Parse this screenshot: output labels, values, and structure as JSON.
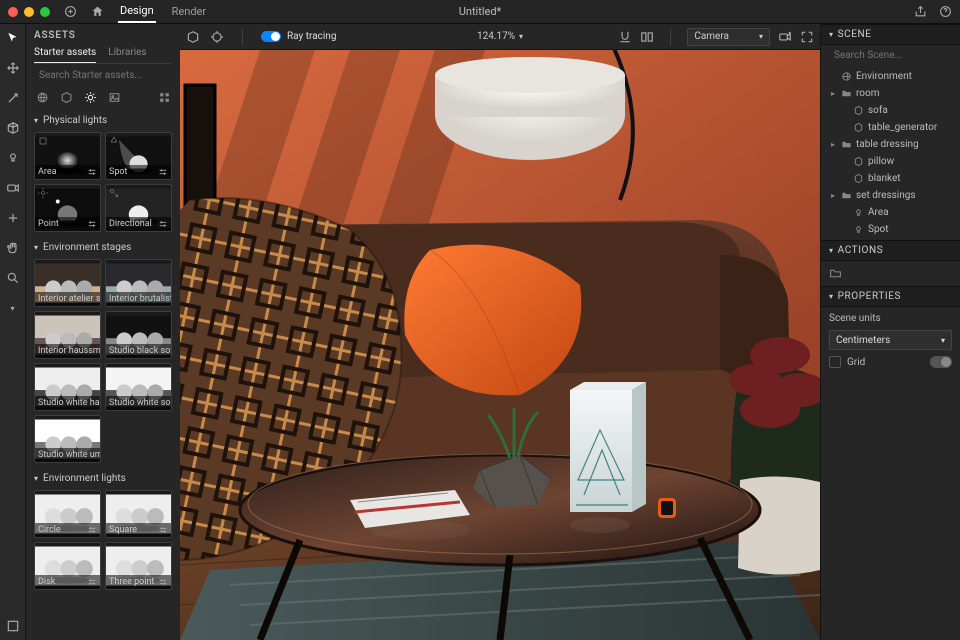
{
  "title": "Untitled*",
  "tabs": {
    "design": "Design",
    "render": "Render"
  },
  "assets": {
    "header": "ASSETS",
    "tabs": {
      "starter": "Starter assets",
      "libraries": "Libraries"
    },
    "search_placeholder": "Search Starter assets...",
    "sections": {
      "physical_lights": "Physical lights",
      "environment_stages": "Environment stages",
      "environment_lights": "Environment lights"
    },
    "lights": [
      {
        "label": "Area"
      },
      {
        "label": "Spot"
      },
      {
        "label": "Point"
      },
      {
        "label": "Directional"
      }
    ],
    "env_stages": [
      {
        "label": "Interior atelier s..."
      },
      {
        "label": "Interior brutalist..."
      },
      {
        "label": "Interior haussm..."
      },
      {
        "label": "Studio black soft..."
      },
      {
        "label": "Studio white ha..."
      },
      {
        "label": "Studio white so..."
      },
      {
        "label": "Studio white um..."
      }
    ],
    "env_lights": [
      {
        "label": "Circle"
      },
      {
        "label": "Square"
      },
      {
        "label": "Disk"
      },
      {
        "label": "Three point"
      }
    ]
  },
  "viewport": {
    "ray_tracing": "Ray tracing",
    "zoom": "124.17%",
    "camera": "Camera"
  },
  "scene": {
    "header": "SCENE",
    "search_placeholder": "Search Scene...",
    "nodes": [
      {
        "label": "Environment",
        "icon": "globe",
        "depth": 0
      },
      {
        "label": "room",
        "icon": "folder",
        "depth": 0,
        "caret": ">"
      },
      {
        "label": "sofa",
        "icon": "cube",
        "depth": 1
      },
      {
        "label": "table_generator",
        "icon": "cube",
        "depth": 1
      },
      {
        "label": "table dressing",
        "icon": "folder",
        "depth": 0,
        "caret": ">"
      },
      {
        "label": "pillow",
        "icon": "cube",
        "depth": 1
      },
      {
        "label": "blanket",
        "icon": "cube",
        "depth": 1
      },
      {
        "label": "set dressings",
        "icon": "folder",
        "depth": 0,
        "caret": ">"
      },
      {
        "label": "Area",
        "icon": "light",
        "depth": 1
      },
      {
        "label": "Spot",
        "icon": "light",
        "depth": 1
      }
    ]
  },
  "actions": {
    "header": "ACTIONS"
  },
  "properties": {
    "header": "PROPERTIES",
    "scene_units_label": "Scene units",
    "scene_units": "Centimeters",
    "grid_label": "Grid"
  },
  "colors": {
    "accent": "#0a84ff"
  }
}
